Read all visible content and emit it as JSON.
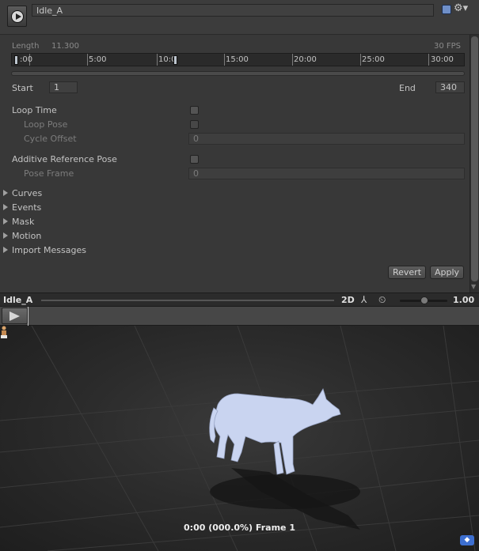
{
  "clip": {
    "name": "Idle_A"
  },
  "header": {
    "help_icon": "help-book-icon",
    "settings_icon": "gear-icon",
    "settings_glyph": "⚙▾"
  },
  "info": {
    "length_label": "Length",
    "length_value": "11.300",
    "fps": "30 FPS"
  },
  "timeline": {
    "ticks": [
      "0:00",
      "5:00",
      "10:00",
      "15:00",
      "20:00",
      "25:00",
      "30:00"
    ],
    "ticks_visible": [
      ":00",
      "5:00",
      "10:0",
      "15:00",
      "20:00",
      "25:00",
      "30:00"
    ]
  },
  "range": {
    "start_label": "Start",
    "start_value": "1",
    "end_label": "End",
    "end_value": "340"
  },
  "options": {
    "loop_time": "Loop Time",
    "loop_pose": "Loop Pose",
    "cycle_offset": "Cycle Offset",
    "cycle_offset_value": "0",
    "additive_ref": "Additive Reference Pose",
    "pose_frame": "Pose Frame",
    "pose_frame_value": "0"
  },
  "foldouts": [
    "Curves",
    "Events",
    "Mask",
    "Motion",
    "Import Messages"
  ],
  "buttons": {
    "revert": "Revert",
    "apply": "Apply"
  },
  "preview": {
    "title": "Idle_A",
    "mode_2d": "2D",
    "speed": "1.00",
    "pivot_icon": "pivot-icon",
    "speed_icon": "playback-speed-icon",
    "frame_label": "0:00 (000.0%) Frame 1",
    "model_icon": "avatar-icon",
    "tag_icon": "asset-label-icon"
  },
  "colors": {
    "panel": "#383838",
    "viewport": "#2c2c2c",
    "model": "#c9d4f0",
    "tag": "#3d6fd0"
  }
}
